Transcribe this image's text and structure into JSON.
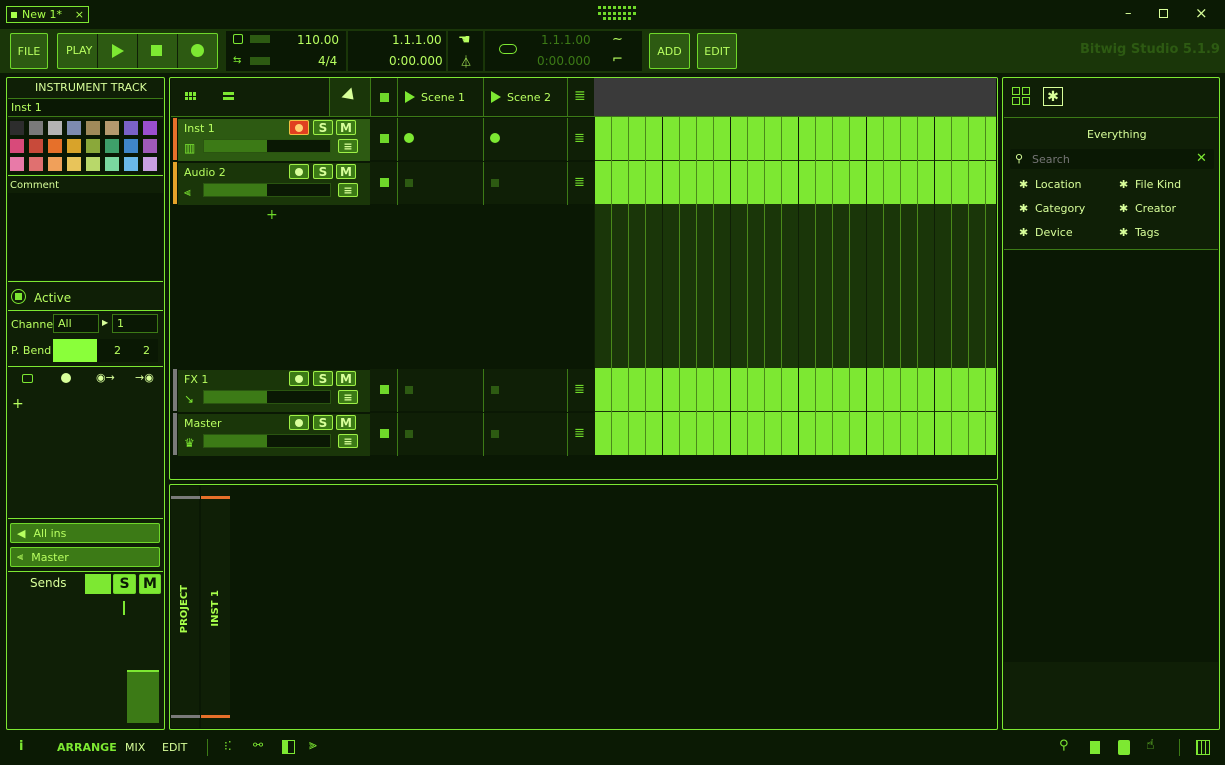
{
  "titlebar": {
    "tab_label": "New 1*",
    "close_tab": "×",
    "minimize": "–",
    "maximize": "□",
    "close": "×"
  },
  "transport": {
    "file": "FILE",
    "play": "PLAY",
    "tempo": "110.00",
    "signature": "4/4",
    "position_beats": "1.1.1.00",
    "position_time": "0:00.000",
    "loop_beats": "1.1.1.00",
    "loop_time": "0:00.000",
    "add": "ADD",
    "edit": "EDIT",
    "app_version": "Bitwig Studio 5.1.9"
  },
  "inspector": {
    "section_title": "INSTRUMENT TRACK",
    "track_name": "Inst 1",
    "comment_label": "Comment",
    "active_label": "Active",
    "channel_label": "Channel",
    "channel_value": "All",
    "channel_num": "1",
    "pbend_label": "P. Bend",
    "pbend_a": "2",
    "pbend_b": "2",
    "input_label": "All ins",
    "output_label": "Master",
    "sends_label": "Sends",
    "solo": "S",
    "mute": "M",
    "add_symbol": "+",
    "colors": [
      "#2d2d2d",
      "#7a7a7a",
      "#b4b4b4",
      "#7d8bb0",
      "#a08a5a",
      "#b59a6e",
      "#7a62c8",
      "#9a4fcf",
      "#d84a7a",
      "#c84a3a",
      "#e6702a",
      "#d8a32a",
      "#8aa83a",
      "#3ea06a",
      "#3f86c8",
      "#a05ab8",
      "#e87aa8",
      "#e07070",
      "#f0a05a",
      "#e8c45a",
      "#b8d86a",
      "#7ad8a0",
      "#6ab8e8",
      "#c8a0e0"
    ]
  },
  "clip_launcher": {
    "scene1": "Scene 1",
    "scene2": "Scene 2",
    "add_track": "+",
    "tracks": [
      {
        "name": "Inst 1",
        "solo": "S",
        "mute": "M",
        "level": 0.5
      },
      {
        "name": "Audio 2",
        "solo": "S",
        "mute": "M",
        "level": 0.5
      },
      {
        "name": "FX 1",
        "solo": "S",
        "mute": "M",
        "level": 0.5
      },
      {
        "name": "Master",
        "solo": "S",
        "mute": "M",
        "level": 0.5
      }
    ]
  },
  "device_panel": {
    "project_tab": "PROJECT",
    "inst_tab": "INST 1"
  },
  "browser": {
    "heading": "Everything",
    "search_placeholder": "Search",
    "filters": [
      "Location",
      "File Kind",
      "Category",
      "Creator",
      "Device",
      "Tags"
    ]
  },
  "statusbar": {
    "info": "i",
    "arrange": "ARRANGE",
    "mix": "MIX",
    "edit": "EDIT"
  }
}
